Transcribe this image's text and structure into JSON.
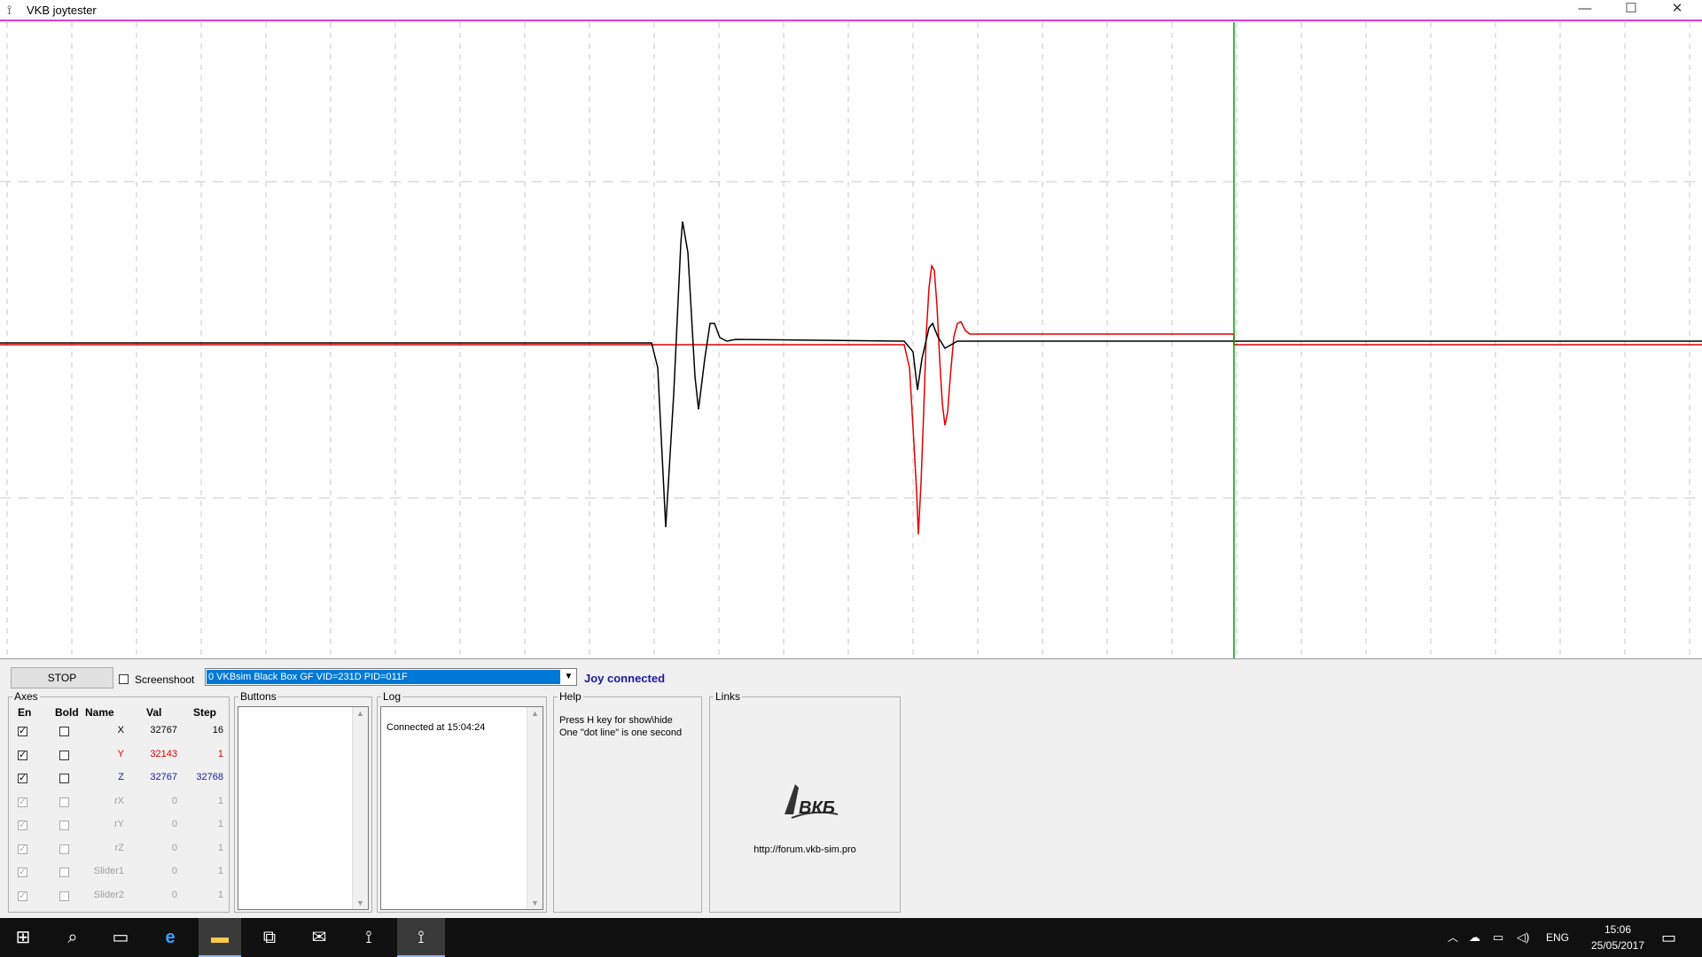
{
  "window": {
    "title": "VKB joytester",
    "app_icon": "joystick-icon",
    "minimize_glyph": "—",
    "maximize_glyph": "☐",
    "close_glyph": "✕"
  },
  "plot": {
    "background": "#ffffff",
    "cursor_color": "#00a000",
    "series": [
      {
        "color": "#000000"
      },
      {
        "color": "#e00000"
      }
    ]
  },
  "controls": {
    "stop_label": "STOP",
    "screenshot_label": "Screenshoot",
    "screenshot_checked": false,
    "device_selected": "0 VKBsim Black Box GF  VID=231D PID=011F",
    "status_text": "Joy connected",
    "status_color": "#1a1aa0"
  },
  "axes": {
    "legend": "Axes",
    "headers": {
      "en": "En",
      "bold": "Bold",
      "name": "Name",
      "val": "Val",
      "step": "Step"
    },
    "rows": [
      {
        "name": "X",
        "val": "32767",
        "step": "16",
        "enabled": true,
        "bold": false,
        "color": "#000000",
        "active": true
      },
      {
        "name": "Y",
        "val": "32143",
        "step": "1",
        "enabled": true,
        "bold": false,
        "color": "#e00000",
        "active": true
      },
      {
        "name": "Z",
        "val": "32767",
        "step": "32768",
        "enabled": true,
        "bold": false,
        "color": "#1a1aa0",
        "active": true
      },
      {
        "name": "rX",
        "val": "0",
        "step": "1",
        "enabled": true,
        "bold": false,
        "color": "#a0a0a0",
        "active": false
      },
      {
        "name": "rY",
        "val": "0",
        "step": "1",
        "enabled": true,
        "bold": false,
        "color": "#a0a0a0",
        "active": false
      },
      {
        "name": "rZ",
        "val": "0",
        "step": "1",
        "enabled": true,
        "bold": false,
        "color": "#a0a0a0",
        "active": false
      },
      {
        "name": "Slider1",
        "val": "0",
        "step": "1",
        "enabled": true,
        "bold": false,
        "color": "#a0a0a0",
        "active": false
      },
      {
        "name": "Slider2",
        "val": "0",
        "step": "1",
        "enabled": true,
        "bold": false,
        "color": "#a0a0a0",
        "active": false
      }
    ]
  },
  "buttons_group": {
    "legend": "Buttons"
  },
  "log_group": {
    "legend": "Log",
    "lines": [
      "Connected at 15:04:24"
    ]
  },
  "help_group": {
    "legend": "Help",
    "line1": "Press H key for show\\hide",
    "line2": "One \"dot line\" is one second"
  },
  "links_group": {
    "legend": "Links",
    "logo_text": "ВКБ",
    "url": "http://forum.vkb-sim.pro"
  },
  "taskbar": {
    "items": [
      "windows-start-icon",
      "search-icon",
      "task-view-icon",
      "edge-icon",
      "file-explorer-icon",
      "store-icon",
      "mail-icon",
      "joystick-app-icon",
      "joytester-icon"
    ],
    "tray_lang": "ENG",
    "time": "15:06",
    "date": "25/05/2017"
  }
}
